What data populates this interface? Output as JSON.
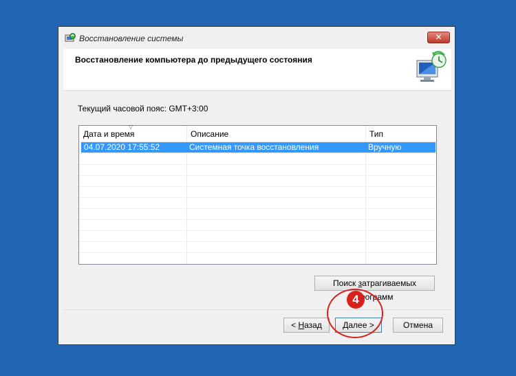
{
  "window": {
    "title": "Восстановление системы",
    "close_label": "✕",
    "header_title": "Восстановление компьютера до предыдущего состояния"
  },
  "timezone_label": "Текущий часовой пояс: GMT+3:00",
  "table": {
    "columns": [
      "Дата и время",
      "Описание",
      "Тип"
    ],
    "sort_indicator": "▽",
    "rows": [
      {
        "date": "04.07.2020 17:55:52",
        "description": "Системная точка восстановления",
        "type": "Вручную",
        "selected": true
      }
    ]
  },
  "buttons": {
    "scan_prefix": "Поиск ",
    "scan_key": "з",
    "scan_suffix": "атрагиваемых программ",
    "back_prefix": "< ",
    "back_key": "Н",
    "back_suffix": "азад",
    "next_key": "Д",
    "next_suffix": "алее >",
    "cancel": "Отмена"
  },
  "annotation": {
    "step": "4"
  },
  "colors": {
    "desktop": "#2166b3",
    "selection": "#3399ff",
    "annotation": "#d8201c"
  },
  "icons": [
    "system-restore-icon",
    "close-icon",
    "restore-computer-graphic",
    "sort-arrow-icon"
  ]
}
